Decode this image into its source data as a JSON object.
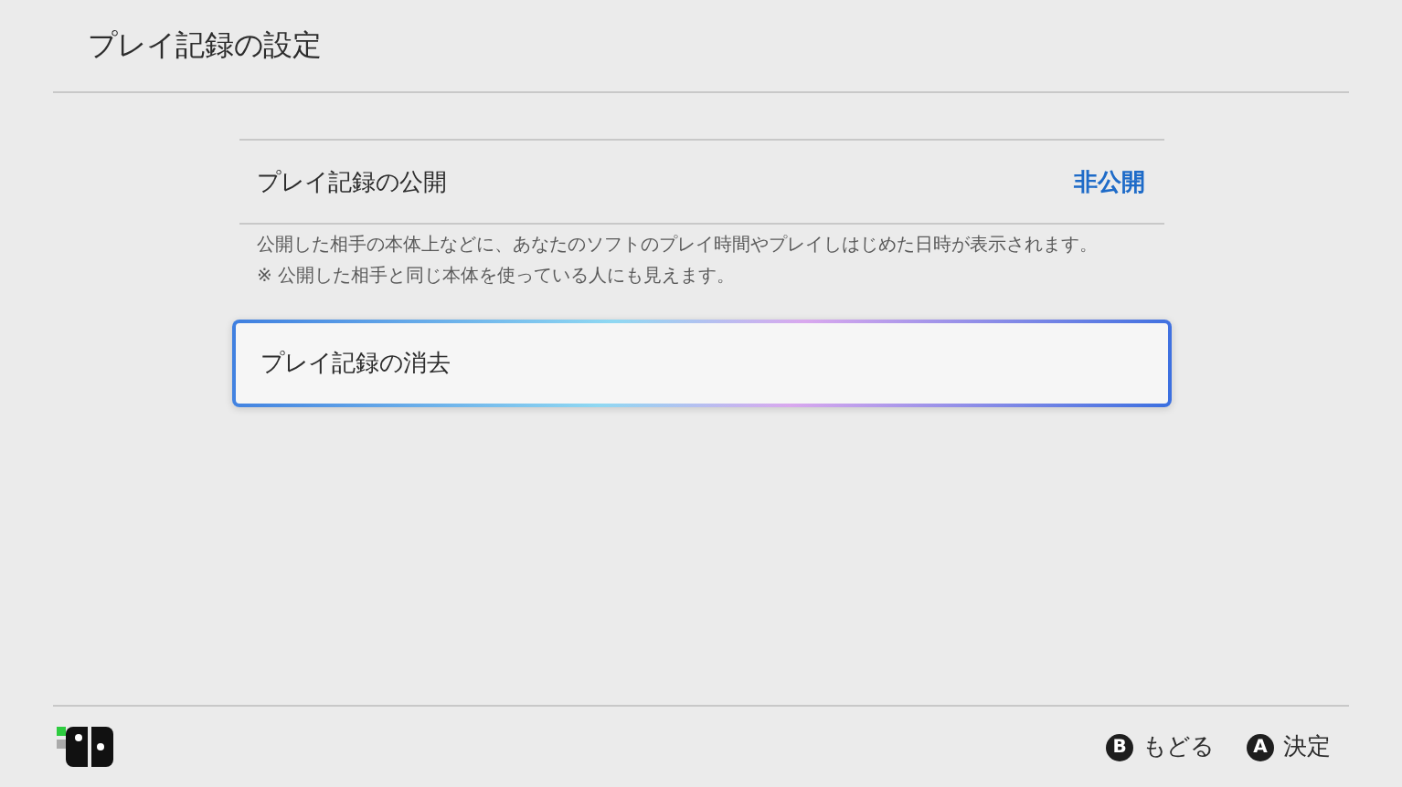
{
  "header": {
    "title": "プレイ記録の設定"
  },
  "settings": [
    {
      "label": "プレイ記録の公開",
      "value": "非公開"
    }
  ],
  "description": [
    "公開した相手の本体上などに、あなたのソフトのプレイ時間やプレイしはじめた日時が表示されます。",
    "※ 公開した相手と同じ本体を使っている人にも見えます。"
  ],
  "actions": [
    {
      "label": "プレイ記録の消去",
      "selected": true
    }
  ],
  "footer": {
    "buttons": [
      {
        "glyph": "B",
        "label": "もどる"
      },
      {
        "glyph": "A",
        "label": "決定"
      }
    ]
  }
}
